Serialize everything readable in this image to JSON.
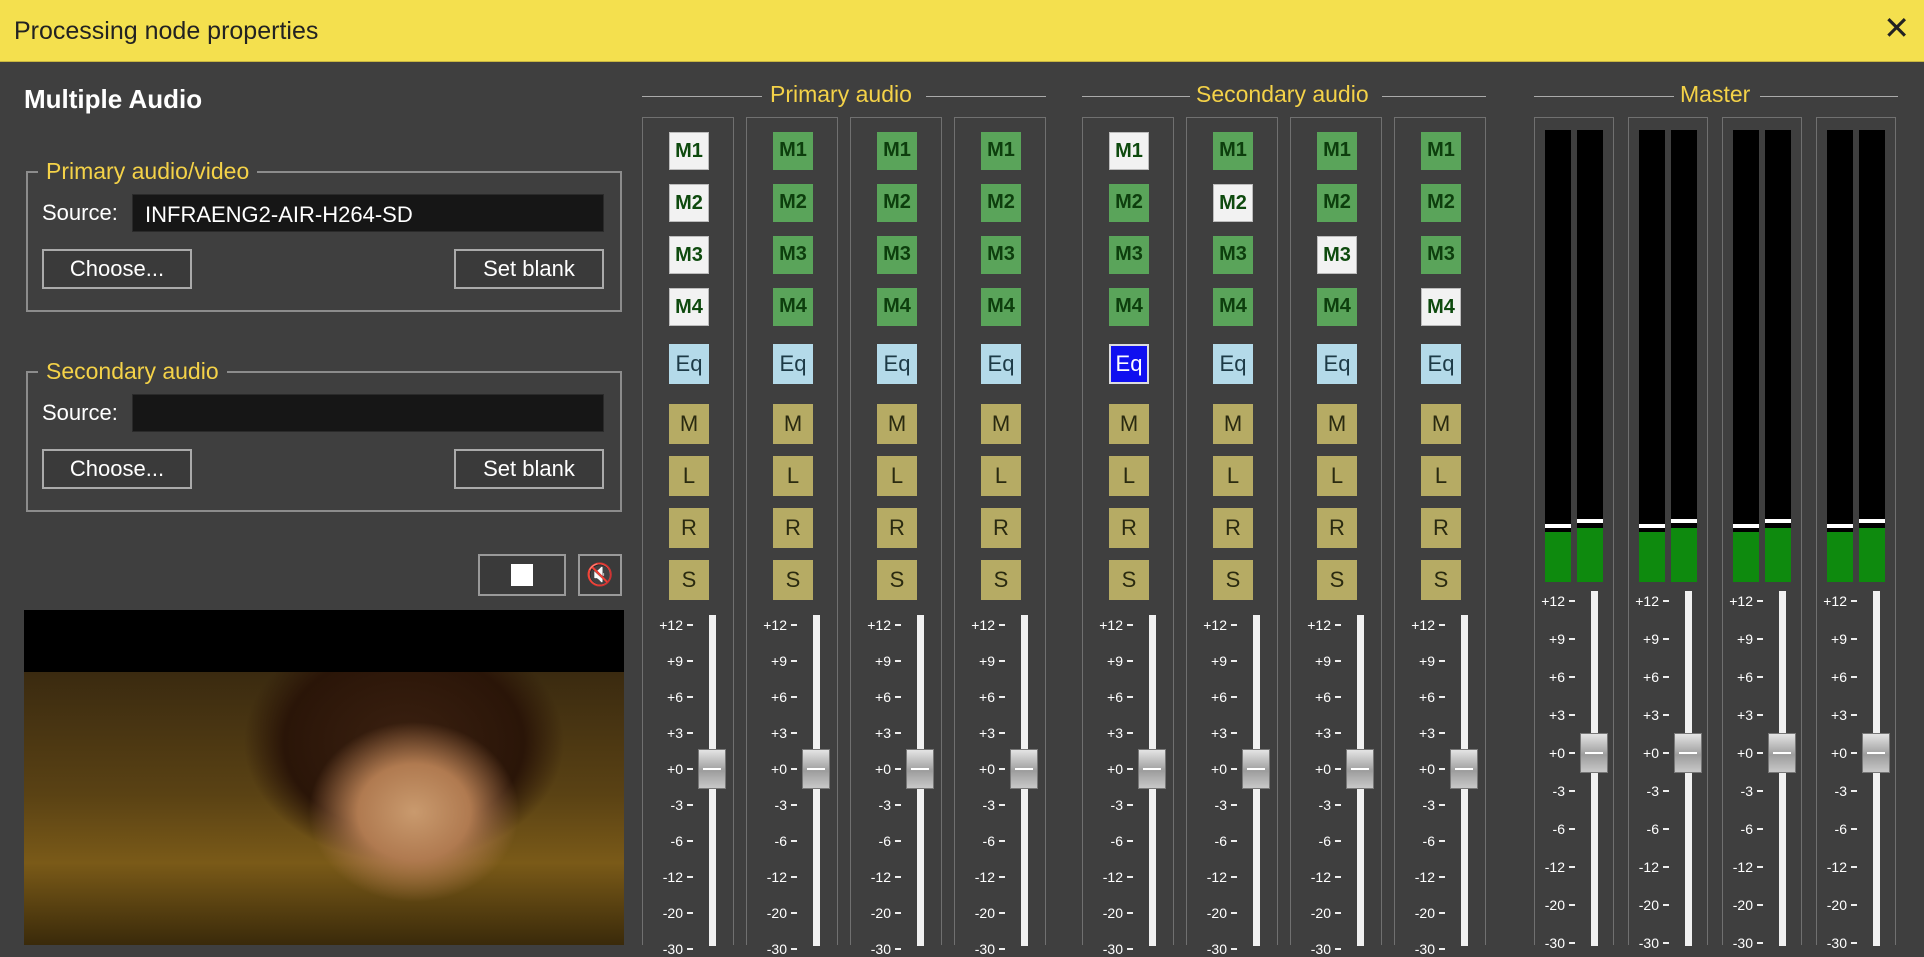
{
  "window": {
    "title": "Processing node properties",
    "close_glyph": "✕"
  },
  "node": {
    "title": "Multiple Audio"
  },
  "primary_av": {
    "legend": "Primary audio/video",
    "source_label": "Source:",
    "source_value": "INFRAENG2-AIR-H264-SD",
    "choose_label": "Choose...",
    "blank_label": "Set blank"
  },
  "secondary_av": {
    "legend": "Secondary audio",
    "source_label": "Source:",
    "source_value": "",
    "choose_label": "Choose...",
    "blank_label": "Set blank"
  },
  "controls": {
    "stop_icon": "stop-icon",
    "mute_icon": "speaker-muted-icon",
    "mute_glyph": "🔇"
  },
  "sections": {
    "primary": "Primary audio",
    "secondary": "Secondary audio",
    "master": "Master"
  },
  "buttons": {
    "m1": "M1",
    "m2": "M2",
    "m3": "M3",
    "m4": "M4",
    "eq": "Eq",
    "mute": "M",
    "left": "L",
    "right": "R",
    "solo": "S"
  },
  "channels": [
    {
      "group": "primary",
      "selected": [
        "M1",
        "M2",
        "M3",
        "M4"
      ],
      "eq_active": false,
      "fader_db": 0
    },
    {
      "group": "primary",
      "selected": [],
      "eq_active": false,
      "fader_db": 0
    },
    {
      "group": "primary",
      "selected": [],
      "eq_active": false,
      "fader_db": 0
    },
    {
      "group": "primary",
      "selected": [],
      "eq_active": false,
      "fader_db": 0
    },
    {
      "group": "secondary",
      "selected": [
        "M1"
      ],
      "eq_active": true,
      "fader_db": 0
    },
    {
      "group": "secondary",
      "selected": [
        "M2"
      ],
      "eq_active": false,
      "fader_db": 0
    },
    {
      "group": "secondary",
      "selected": [
        "M3"
      ],
      "eq_active": false,
      "fader_db": 0
    },
    {
      "group": "secondary",
      "selected": [
        "M4"
      ],
      "eq_active": false,
      "fader_db": 0
    }
  ],
  "channel_scale": [
    "+12",
    "+9",
    "+6",
    "+3",
    "+0",
    "-3",
    "-6",
    "-12",
    "-20",
    "-30"
  ],
  "master_scale": [
    "+12",
    "+9",
    "+6",
    "+3",
    "+0",
    "-3",
    "-6",
    "-12",
    "-20",
    "-30"
  ],
  "master_channels": [
    {
      "meters": [
        {
          "level": 0.11,
          "peak": 0.12
        },
        {
          "level": 0.12,
          "peak": 0.13
        }
      ],
      "fader_db": 0
    },
    {
      "meters": [
        {
          "level": 0.11,
          "peak": 0.12
        },
        {
          "level": 0.12,
          "peak": 0.13
        }
      ],
      "fader_db": 0
    },
    {
      "meters": [
        {
          "level": 0.11,
          "peak": 0.12
        },
        {
          "level": 0.12,
          "peak": 0.13
        }
      ],
      "fader_db": 0
    },
    {
      "meters": [
        {
          "level": 0.11,
          "peak": 0.12
        },
        {
          "level": 0.12,
          "peak": 0.13
        }
      ],
      "fader_db": 0
    }
  ],
  "colors": {
    "titlebar": "#f4e04e",
    "legend_text": "#f4d248",
    "matrix_on": "#5aa45a",
    "eq": "#b4dae9",
    "eq_active": "#1010f0",
    "solo_btn": "#b6ab64",
    "meter_fill": "#0e8a0e"
  }
}
